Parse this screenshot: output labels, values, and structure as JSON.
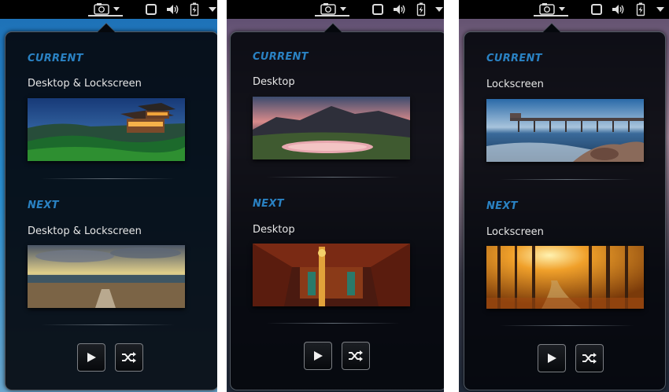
{
  "panels": [
    {
      "id": "panel-1",
      "current": {
        "heading": "CURRENT",
        "target": "Desktop & Lockscreen",
        "thumbnail": "japanese-temple-hillside-image"
      },
      "next": {
        "heading": "NEXT",
        "target": "Desktop & Lockscreen",
        "thumbnail": "beach-sunset-boardwalk-image"
      },
      "buttons": {
        "play": "play-icon",
        "shuffle": "shuffle-icon"
      }
    },
    {
      "id": "panel-2",
      "current": {
        "heading": "CURRENT",
        "target": "Desktop",
        "thumbnail": "mountain-lake-sunset-image"
      },
      "next": {
        "heading": "NEXT",
        "target": "Desktop",
        "thumbnail": "ornate-temple-interior-image"
      },
      "buttons": {
        "play": "play-icon",
        "shuffle": "shuffle-icon"
      }
    },
    {
      "id": "panel-3",
      "current": {
        "heading": "CURRENT",
        "target": "Lockscreen",
        "thumbnail": "ocean-pier-rocks-image"
      },
      "next": {
        "heading": "NEXT",
        "target": "Lockscreen",
        "thumbnail": "autumn-forest-path-image"
      },
      "buttons": {
        "play": "play-icon",
        "shuffle": "shuffle-icon"
      }
    }
  ],
  "topbar_icons": [
    "camera-icon",
    "dropdown-arrow-icon",
    "window-icon",
    "volume-icon",
    "battery-icon",
    "system-menu-arrow-icon"
  ],
  "colors": {
    "heading": "#2a82c3",
    "label": "#e6e6e6",
    "popup_bg": "#05080d",
    "popup_border": "#525a63"
  }
}
